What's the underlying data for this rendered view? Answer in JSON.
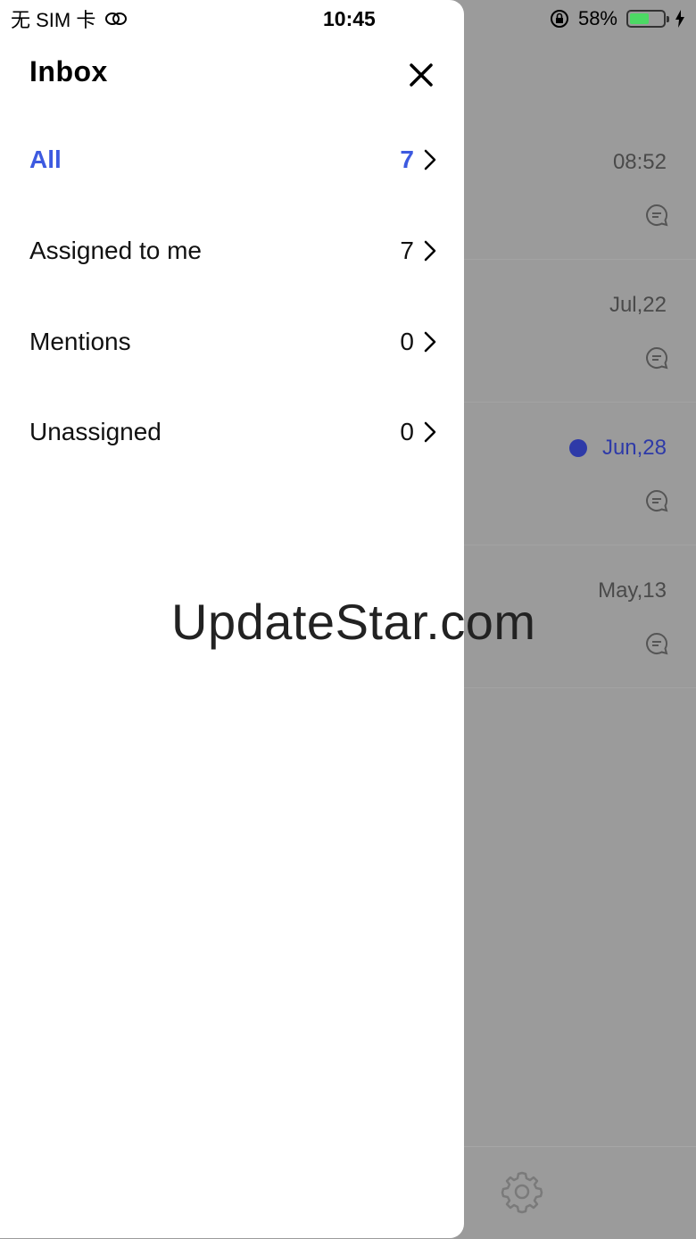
{
  "status_bar": {
    "carrier": "无 SIM 卡",
    "time": "10:45",
    "battery_percent": "58%",
    "battery_level": 0.58,
    "battery_color": "#4cd964"
  },
  "drawer": {
    "title": "Inbox",
    "close_icon": "close-icon",
    "accent_color": "#3d5ae0",
    "items": [
      {
        "label": "All",
        "count": "7",
        "active": true
      },
      {
        "label": "Assigned to me",
        "count": "7",
        "active": false
      },
      {
        "label": "Mentions",
        "count": "0",
        "active": false
      },
      {
        "label": "Unassigned",
        "count": "0",
        "active": false
      }
    ]
  },
  "background_list": {
    "rows": [
      {
        "date": "08:52",
        "unread": false
      },
      {
        "date": "Jul,22",
        "unread": false
      },
      {
        "date": "Jun,28",
        "unread": true
      },
      {
        "date": "May,13",
        "unread": false
      }
    ],
    "unread_color": "#2e3aa8"
  },
  "bottom_bar": {
    "settings_icon": "gear-icon"
  },
  "watermark": "UpdateStar.com"
}
